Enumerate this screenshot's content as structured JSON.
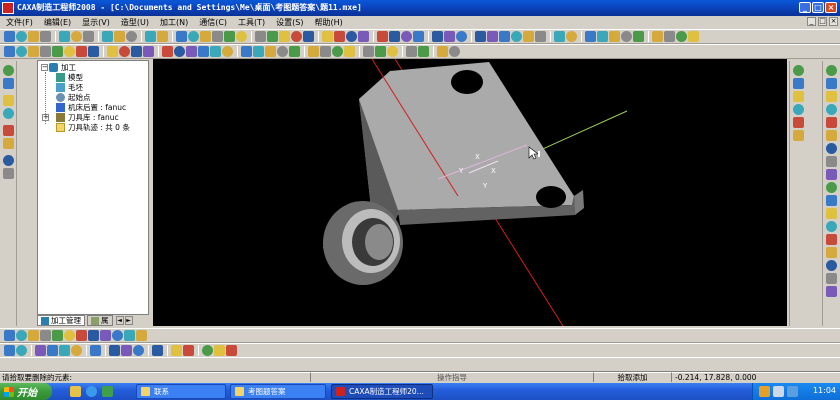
{
  "window": {
    "title": "CAXA制造工程师2008  - [C:\\Documents and Settings\\Me\\桌面\\考图题答案\\题11.mxe]",
    "controls": [
      "_",
      "□",
      "×"
    ]
  },
  "menu": {
    "items": [
      "文件(F)",
      "编辑(E)",
      "显示(V)",
      "造型(U)",
      "加工(N)",
      "通信(C)",
      "工具(T)",
      "设置(S)",
      "帮助(H)"
    ],
    "doc_controls": [
      "_",
      "□",
      "×"
    ]
  },
  "tree": {
    "root": "加工",
    "nodes": [
      {
        "label": "模型",
        "icon": "model-icon"
      },
      {
        "label": "毛坯",
        "icon": "blank-stock-icon"
      },
      {
        "label": "起始点",
        "icon": "start-point-icon"
      },
      {
        "label": "机床后置 : fanuc",
        "icon": "machine-post-icon"
      },
      {
        "label": "刀具库 : fanuc",
        "icon": "tool-library-icon"
      },
      {
        "label": "刀具轨迹 : 共 0 条",
        "icon": "toolpath-folder-icon"
      }
    ]
  },
  "panel_tabs": {
    "active": "加工管理",
    "inactive": "属",
    "arrows": [
      "◄",
      "►"
    ]
  },
  "viewport": {
    "background": "#000000",
    "axis_colors": {
      "x_axis": "#9ccf58",
      "z_axis": "#d21d1d",
      "y_axis": "#dcb6dc"
    },
    "axis_labels": [
      "Y",
      "X",
      "X",
      "Y"
    ],
    "model_face_colors": {
      "top": "#aaaaaa",
      "front": "#626262",
      "side": "#8a8a8a"
    }
  },
  "status": {
    "prompt": "请拾取要删除的元素:",
    "command": "操作指导",
    "mode": "拾取添加",
    "coordinates": "-0.214, 17.828, 0.000"
  },
  "taskbar": {
    "start_label": "开始",
    "tasks": [
      {
        "label": "联系",
        "icon": "folder-icon"
      },
      {
        "label": "考图题答案",
        "icon": "folder-icon"
      },
      {
        "label": "CAXA制造工程师20...",
        "icon": "caxa-app-icon"
      }
    ],
    "clock": "11:04"
  }
}
